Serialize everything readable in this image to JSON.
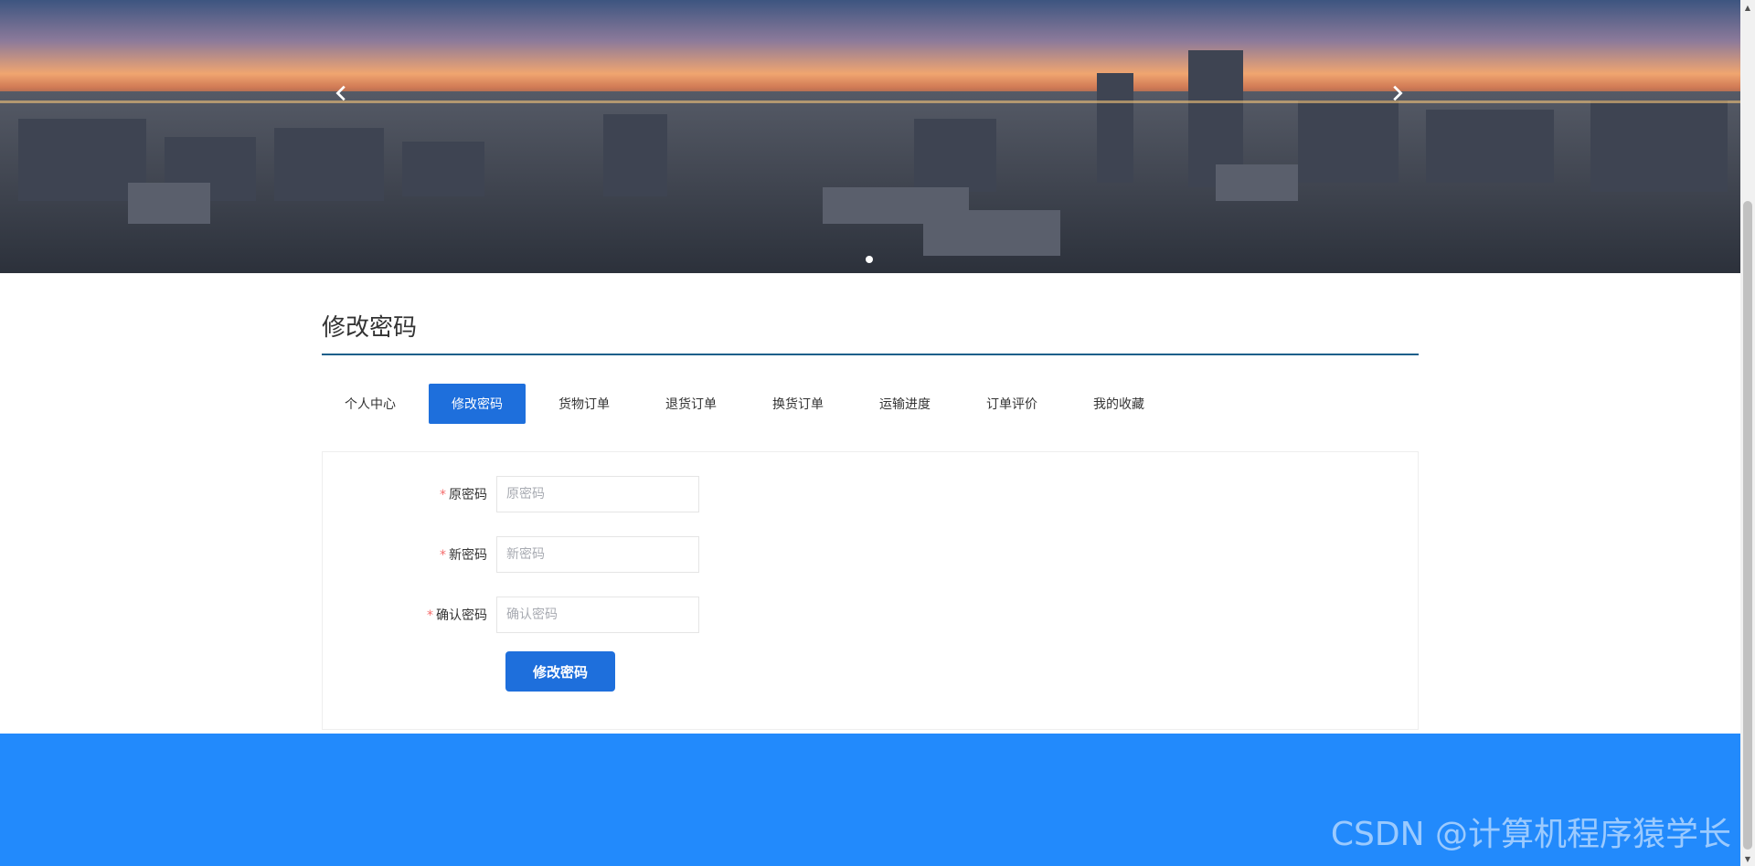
{
  "banner": {
    "prev_icon": "chevron-left-icon",
    "next_icon": "chevron-right-icon",
    "active_slide": 1,
    "slide_count": 1
  },
  "page": {
    "title": "修改密码"
  },
  "tabs": [
    {
      "label": "个人中心",
      "active": false
    },
    {
      "label": "修改密码",
      "active": true
    },
    {
      "label": "货物订单",
      "active": false
    },
    {
      "label": "退货订单",
      "active": false
    },
    {
      "label": "换货订单",
      "active": false
    },
    {
      "label": "运输进度",
      "active": false
    },
    {
      "label": "订单评价",
      "active": false
    },
    {
      "label": "我的收藏",
      "active": false
    }
  ],
  "form": {
    "old_password": {
      "label": "原密码",
      "placeholder": "原密码",
      "value": ""
    },
    "new_password": {
      "label": "新密码",
      "placeholder": "新密码",
      "value": ""
    },
    "confirm_password": {
      "label": "确认密码",
      "placeholder": "确认密码",
      "value": ""
    },
    "required_mark": "*",
    "submit_label": "修改密码"
  },
  "watermark": "CSDN @计算机程序猿学长",
  "colors": {
    "accent": "#1e6fdc",
    "footer": "#228afc",
    "title_underline": "#1a5f8a",
    "required": "#f56c6c"
  }
}
